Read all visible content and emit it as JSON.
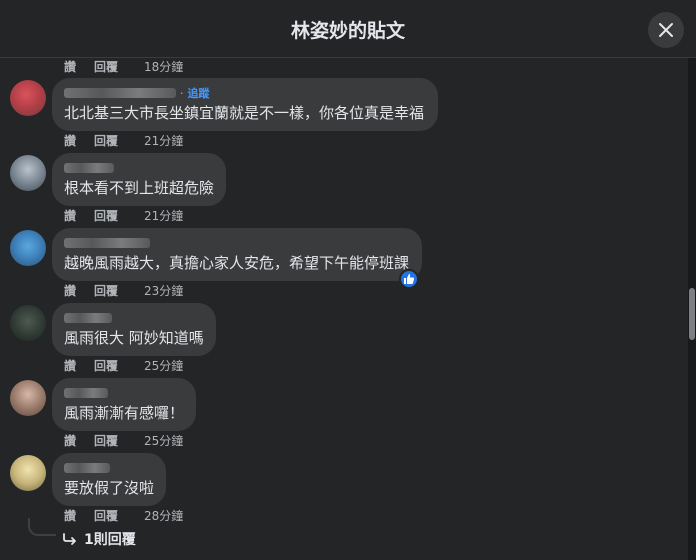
{
  "header": {
    "title": "林姿妙的貼文"
  },
  "actions": {
    "like": "讚",
    "reply": "回覆"
  },
  "comments": [
    {
      "text": "",
      "time": "18分鐘"
    },
    {
      "text": "北北基三大市長坐鎮宜蘭就是不一樣，你各位真是幸福",
      "follow": "追蹤",
      "time": "21分鐘"
    },
    {
      "text": "根本看不到上班超危險",
      "time": "21分鐘"
    },
    {
      "text": "越晚風雨越大，真擔心家人安危，希望下午能停班課",
      "time": "23分鐘",
      "reaction": "like-icon"
    },
    {
      "text": "風雨很大 阿妙知道嗎",
      "time": "25分鐘"
    },
    {
      "text": "風雨漸漸有感囉！",
      "time": "25分鐘"
    },
    {
      "text": "要放假了沒啦",
      "time": "28分鐘"
    }
  ],
  "reply_link": {
    "label": "1則回覆"
  },
  "colors": {
    "bubble": "#3a3b3c",
    "link": "#4599ff",
    "reaction": "#2374e1"
  }
}
